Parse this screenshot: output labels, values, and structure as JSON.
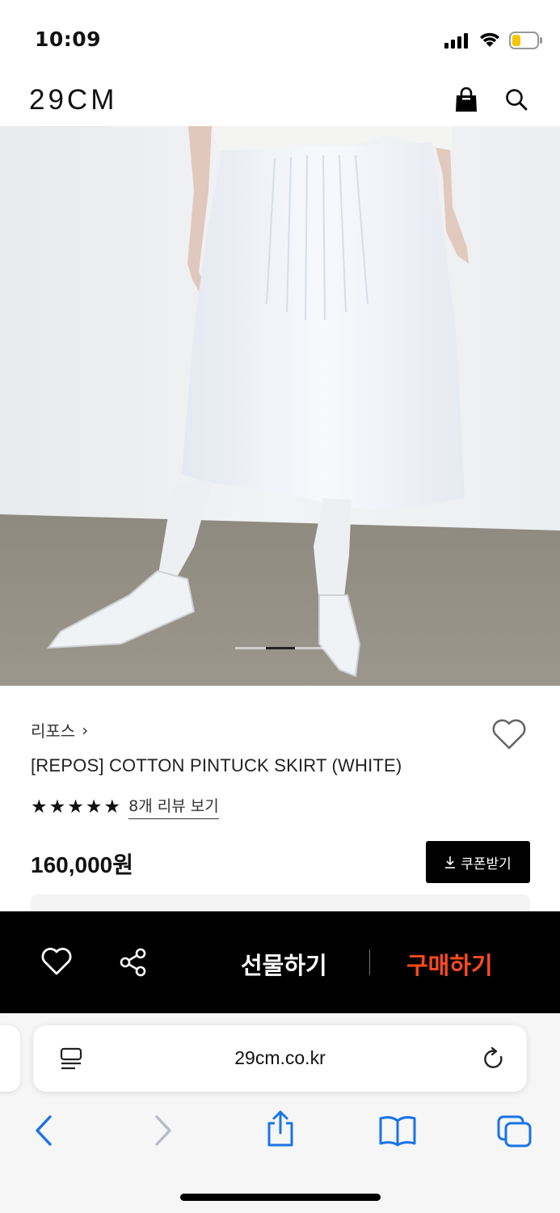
{
  "status_bar": {
    "time": "10:09"
  },
  "header": {
    "logo": "29CM",
    "icons": [
      "shopping-bag-icon",
      "search-icon"
    ]
  },
  "gallery": {
    "image_description": "white pintuck skirt with white tights and pointed flats",
    "page_indicator": "2"
  },
  "product": {
    "brand": "리포스",
    "brand_chevron": "›",
    "name": "[REPOS] COTTON PINTUCK SKIRT (WHITE)",
    "rating_stars": 5,
    "review_link": "8개 리뷰 보기",
    "price": "160,000원",
    "coupon_button": "쿠폰받기"
  },
  "action_bar": {
    "gift_label": "선물하기",
    "buy_label": "구매하기",
    "buy_color": "#ff4b1f"
  },
  "browser": {
    "url": "29cm.co.kr"
  }
}
